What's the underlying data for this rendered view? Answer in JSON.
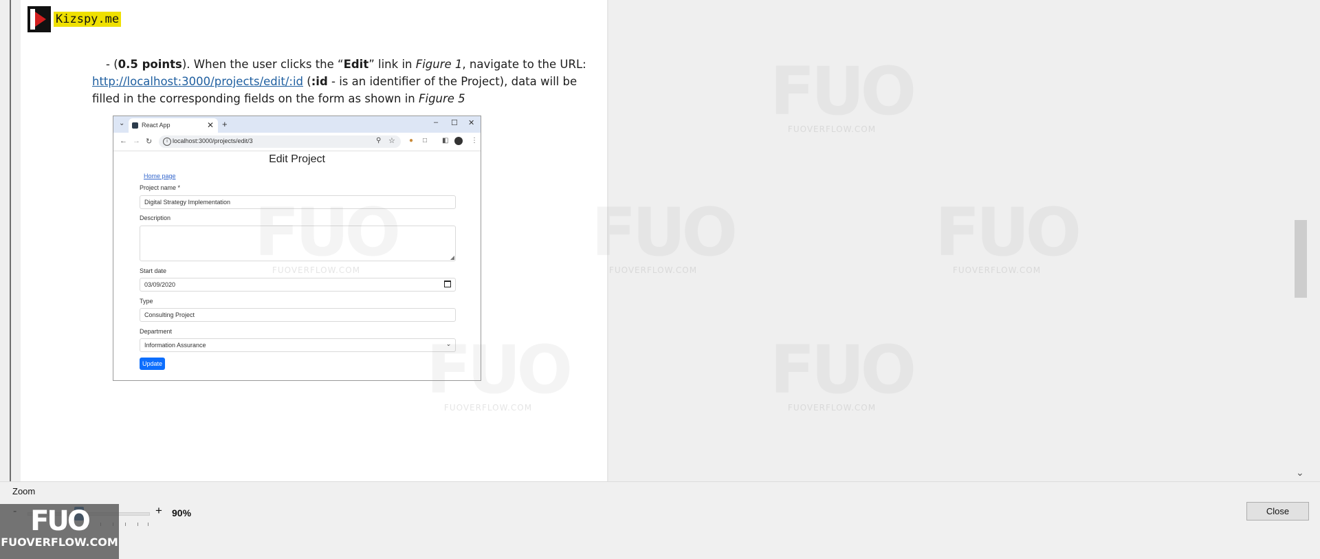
{
  "logo": {
    "text": "Kizspy.me"
  },
  "document": {
    "line1": {
      "prefix": "- (",
      "points": "0.5 points",
      "middle1": "). When the user clicks the “",
      "edit": "Edit",
      "middle2": "” link in ",
      "figure": "Figure 1",
      "suffix": ", navigate to the URL:"
    },
    "line2": {
      "url": "http://localhost:3000/projects/edit/:id",
      "paren": " (",
      "id_token": ":id",
      "rest": " - is an identifier of the Project), data will be"
    },
    "line3": {
      "text": "filled in the corresponding fields on the form as shown in ",
      "figure": "Figure 5"
    }
  },
  "figure": {
    "tab_title": "React App",
    "url": "localhost:3000/projects/edit/3",
    "page_title": "Edit Project",
    "home_link": "Home page",
    "fields": {
      "project_name_label": "Project name *",
      "project_name_value": "Digital Strategy Implementation",
      "description_label": "Description",
      "description_value": "",
      "start_date_label": "Start date",
      "start_date_value": "03/09/2020",
      "type_label": "Type",
      "type_value": "Consulting Project",
      "department_label": "Department",
      "department_value": "Information Assurance"
    },
    "update_button": "Update"
  },
  "watermark": {
    "big": "FUO",
    "small": "FUOVERFLOW.COM"
  },
  "zoom": {
    "label": "Zoom",
    "minus": "-",
    "plus": "+",
    "value": "90%",
    "level_percent": 90
  },
  "close_button": "Close",
  "badge": {
    "big": "FUO",
    "small": "FUOVERFLOW.COM"
  }
}
